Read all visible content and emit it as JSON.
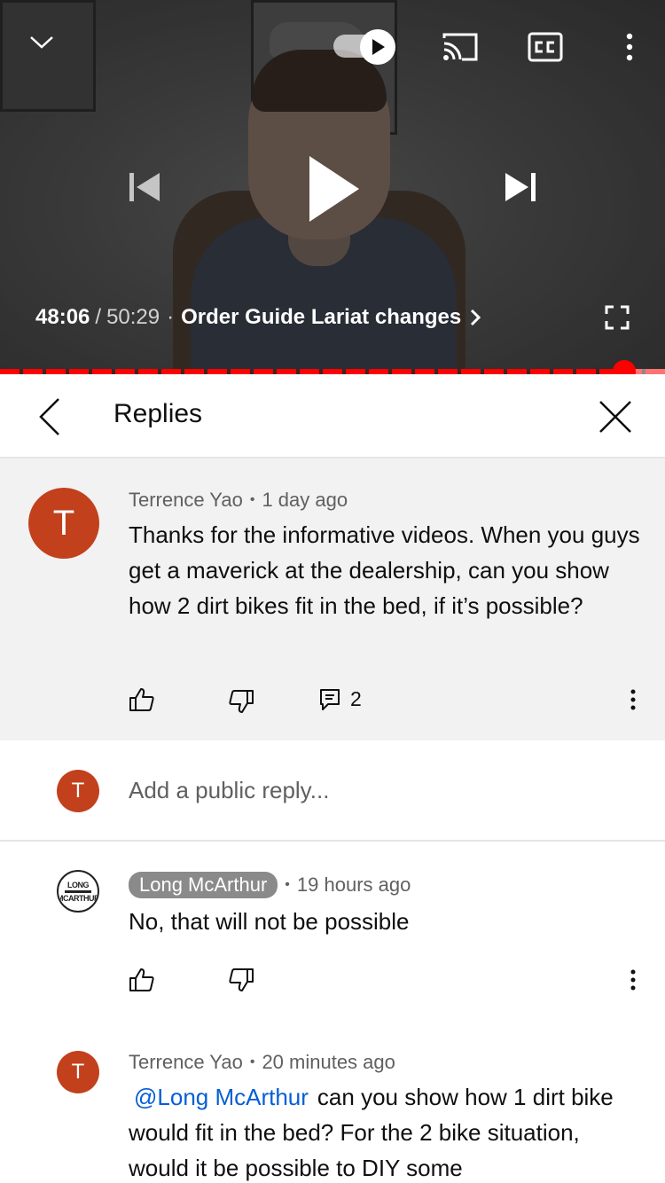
{
  "player": {
    "current_time": "48:06",
    "time_separator": "/",
    "duration": "50:29",
    "dot": "·",
    "chapter_title": "Order Guide Lariat changes",
    "progress_fraction": 0.938,
    "accent_color": "#ff0000",
    "icons": [
      "chevron-down-icon",
      "autoplay-toggle-icon",
      "cast-icon",
      "cc-icon",
      "more-vert-icon",
      "previous-icon",
      "play-icon",
      "next-icon",
      "fullscreen-icon"
    ]
  },
  "replies_panel": {
    "title": "Replies",
    "back_icon": "chevron-left-icon",
    "close_icon": "close-icon"
  },
  "parent_comment": {
    "avatar_letter": "T",
    "avatar_color": "#c2401c",
    "author": "Terrence Yao",
    "bullet": "•",
    "time": "1 day ago",
    "text": "Thanks for the informative videos. When you guys get a maverick at the dealership, can you show how 2 dirt bikes fit in the bed, if it’s possible?",
    "reply_count": "2"
  },
  "reply_input": {
    "avatar_letter": "T",
    "placeholder": "Add a public reply..."
  },
  "replies": [
    {
      "avatar_text_1": "LONG",
      "avatar_text_2": "MCARTHUR",
      "author": "Long McArthur",
      "bullet": "•",
      "time": "19 hours ago",
      "text": "No, that will not be possible"
    },
    {
      "avatar_letter": "T",
      "author": "Terrence Yao",
      "bullet": "•",
      "time": "20 minutes ago",
      "mention": "@Long McArthur",
      "text": "can you show how 1 dirt bike would fit in the bed? For the 2 bike situation, would it be possible to DIY some"
    }
  ]
}
